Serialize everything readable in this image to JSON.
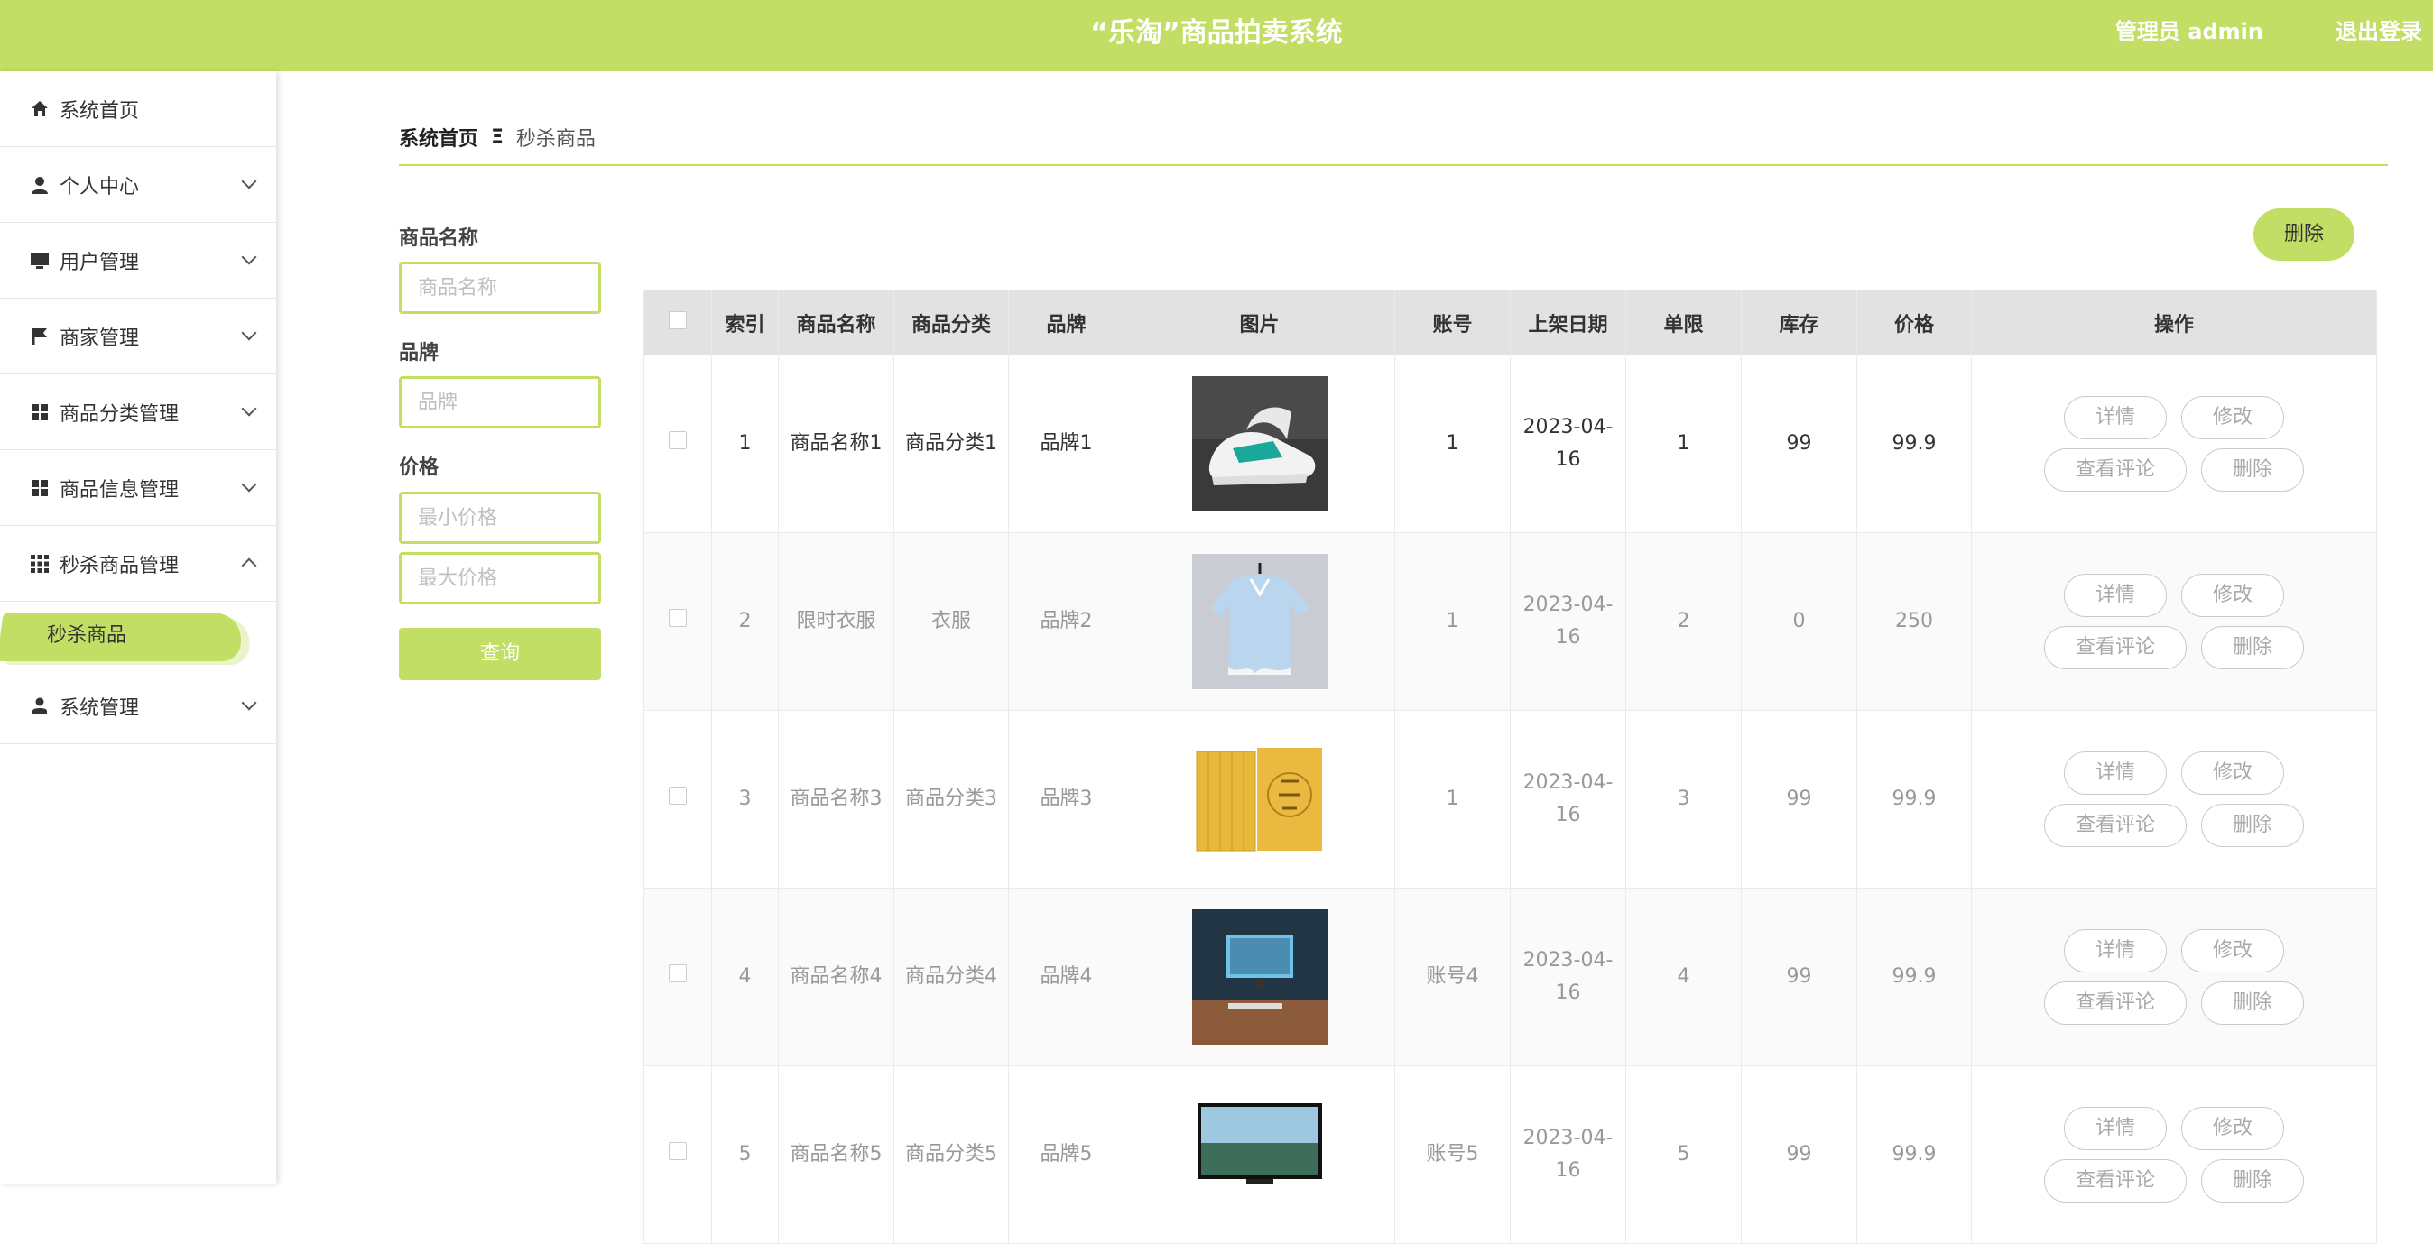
{
  "header": {
    "title": "“乐淘”商品拍卖系统",
    "admin": "管理员 admin",
    "logout": "退出登录"
  },
  "sidebar": {
    "items": [
      {
        "label": "系统首页",
        "icon": "home-icon"
      },
      {
        "label": "个人中心",
        "icon": "person-icon"
      },
      {
        "label": "用户管理",
        "icon": "monitor-icon"
      },
      {
        "label": "商家管理",
        "icon": "flag-icon"
      },
      {
        "label": "商品分类管理",
        "icon": "grid-icon"
      },
      {
        "label": "商品信息管理",
        "icon": "grid-icon"
      },
      {
        "label": "秒杀商品管理",
        "icon": "apps-icon"
      },
      {
        "label": "系统管理",
        "icon": "user-icon"
      }
    ],
    "sub_active": "秒杀商品"
  },
  "breadcrumb": {
    "home": "系统首页",
    "sep": "Ξ",
    "current": "秒杀商品"
  },
  "filters": {
    "name_label": "商品名称",
    "name_placeholder": "商品名称",
    "brand_label": "品牌",
    "brand_placeholder": "品牌",
    "price_label": "价格",
    "min_placeholder": "最小价格",
    "max_placeholder": "最大价格",
    "query": "查询"
  },
  "actions": {
    "delete": "删除"
  },
  "table": {
    "headers": [
      "索引",
      "商品名称",
      "商品分类",
      "品牌",
      "图片",
      "账号",
      "上架日期",
      "单限",
      "库存",
      "价格",
      "操作"
    ],
    "rows": [
      {
        "index": "1",
        "name": "商品名称1",
        "category": "商品分类1",
        "brand": "品牌1",
        "image": "sneaker",
        "account": "1",
        "date": "2023-04-16",
        "limit": "1",
        "stock": "99",
        "price": "99.9"
      },
      {
        "index": "2",
        "name": "限时衣服",
        "category": "衣服",
        "brand": "品牌2",
        "image": "shirt",
        "account": "1",
        "date": "2023-04-16",
        "limit": "2",
        "stock": "0",
        "price": "250"
      },
      {
        "index": "3",
        "name": "商品名称3",
        "category": "商品分类3",
        "brand": "品牌3",
        "image": "books",
        "account": "1",
        "date": "2023-04-16",
        "limit": "3",
        "stock": "99",
        "price": "99.9"
      },
      {
        "index": "4",
        "name": "商品名称4",
        "category": "商品分类4",
        "brand": "品牌4",
        "image": "desk-monitor",
        "account": "账号4",
        "date": "2023-04-16",
        "limit": "4",
        "stock": "99",
        "price": "99.9"
      },
      {
        "index": "5",
        "name": "商品名称5",
        "category": "商品分类5",
        "brand": "品牌5",
        "image": "tv",
        "account": "账号5",
        "date": "2023-04-16",
        "limit": "5",
        "stock": "99",
        "price": "99.9"
      }
    ],
    "ops": {
      "detail": "详情",
      "edit": "修改",
      "comments": "查看评论",
      "delete": "删除"
    }
  },
  "colors": {
    "accent": "#c3de64",
    "header_bg": "#c3de64",
    "table_header_bg": "#e2e2e2"
  }
}
